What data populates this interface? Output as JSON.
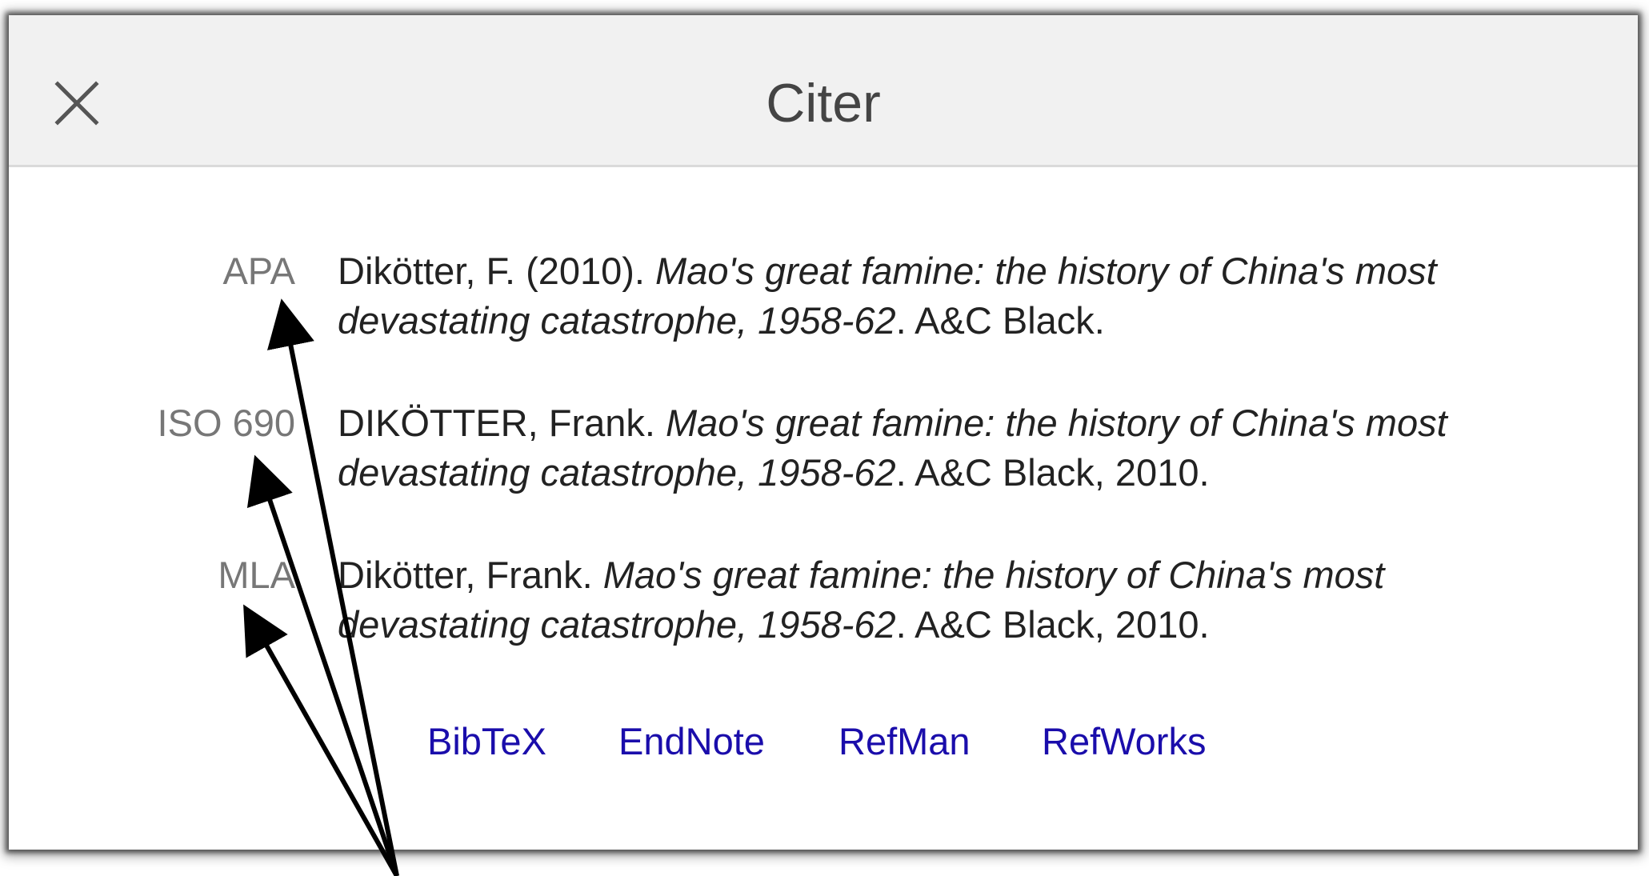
{
  "dialog": {
    "title": "Citer",
    "close_label": "close"
  },
  "citations": [
    {
      "style": "APA",
      "before": "Dikötter, F. (2010). ",
      "title": "Mao's great famine: the history of China's most devastating catastrophe, 1958-62",
      "after": ". A&C Black."
    },
    {
      "style": "ISO 690",
      "before": "DIKÖTTER, Frank. ",
      "title": "Mao's great famine: the history of China's most devastating catastrophe, 1958-62",
      "after": ". A&C Black, 2010."
    },
    {
      "style": "MLA",
      "before": "Dikötter, Frank. ",
      "title": "Mao's great famine: the history of China's most devastating catastrophe, 1958-62",
      "after": ". A&C Black, 2010."
    }
  ],
  "export_links": [
    "BibTeX",
    "EndNote",
    "RefMan",
    "RefWorks"
  ],
  "colors": {
    "link": "#1a0dab",
    "label": "#777777",
    "text": "#222222",
    "header_bg": "#f1f1f1",
    "annotation_arrow": "#000000"
  },
  "icons": {
    "close": "close-icon"
  }
}
